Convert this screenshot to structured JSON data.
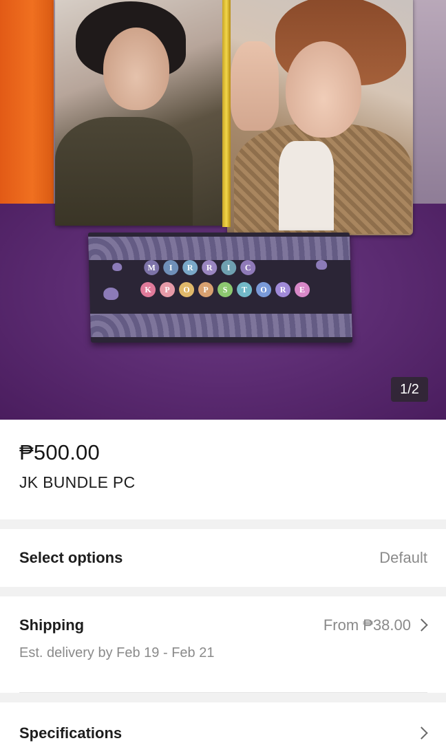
{
  "gallery": {
    "counter": "1/2"
  },
  "product": {
    "price": "₱500.00",
    "name": "JK BUNDLE PC"
  },
  "options": {
    "title": "Select options",
    "value": "Default"
  },
  "shipping": {
    "title": "Shipping",
    "price": "From ₱38.00",
    "estimate": "Est. delivery by Feb 19 - Feb 21"
  },
  "specifications": {
    "title": "Specifications"
  },
  "store_card": {
    "row1": [
      "M",
      "I",
      "R",
      "R",
      "I",
      "C"
    ],
    "row2": [
      "K",
      "P",
      "O",
      "P",
      "S",
      "T",
      "O",
      "R",
      "E"
    ],
    "row1_colors": [
      "#7d73a8",
      "#6f8fb8",
      "#7aa8c8",
      "#9a86c0",
      "#6fa0b0",
      "#8f7ab8"
    ],
    "row2_colors": [
      "#e07a9a",
      "#e69aa8",
      "#e0b86a",
      "#d8a070",
      "#8cc870",
      "#72b8c8",
      "#7a9ad8",
      "#a08ad8",
      "#d888c8"
    ]
  }
}
